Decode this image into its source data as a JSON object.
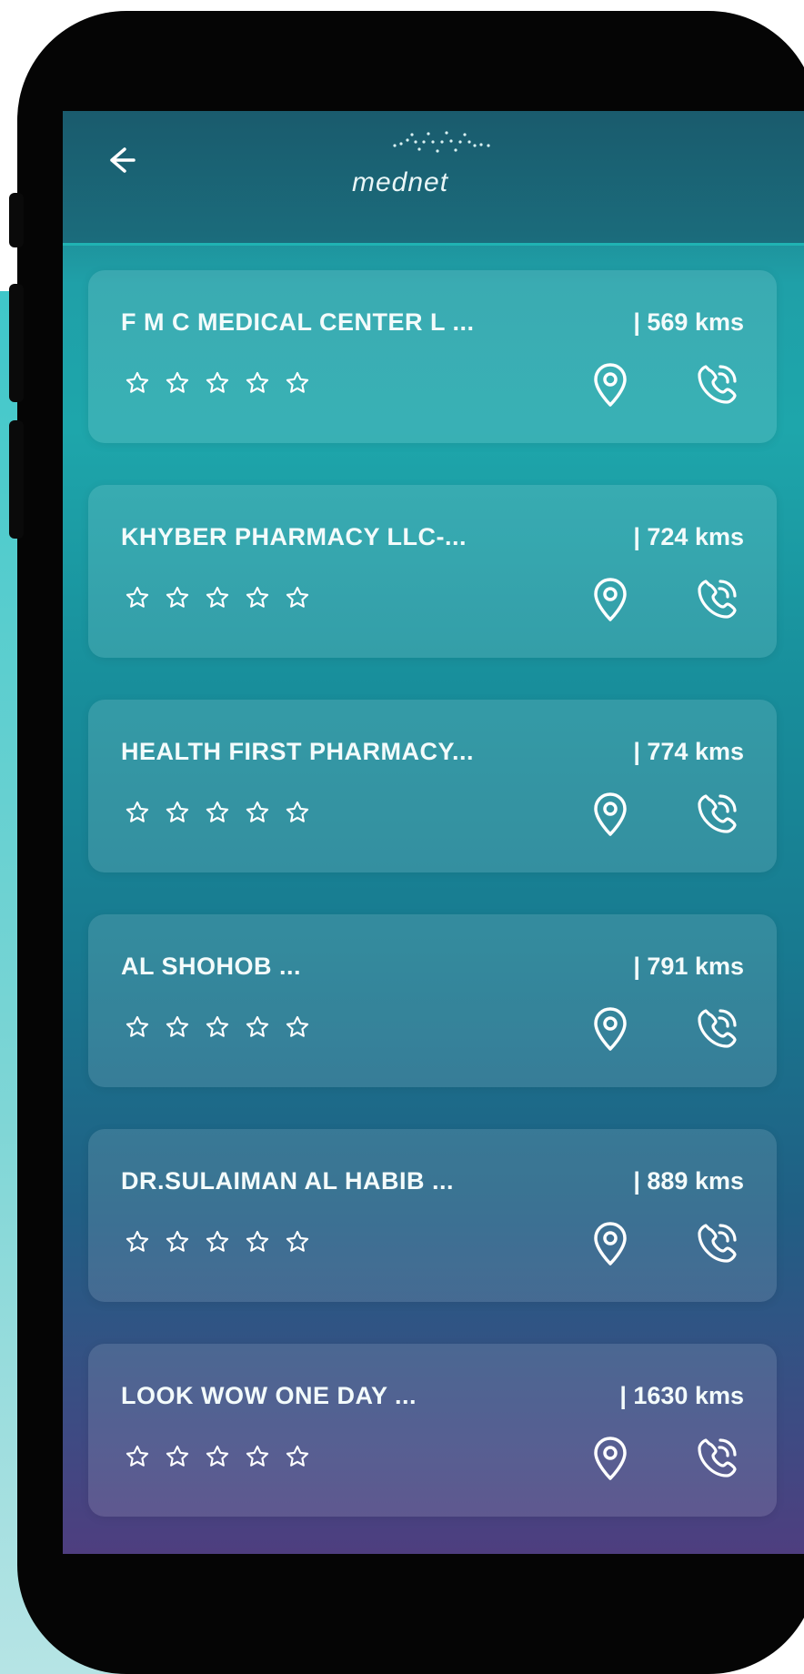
{
  "header": {
    "back_icon": "arrow-left-icon",
    "logo_text": "mednet"
  },
  "facilities": [
    {
      "name": "F M C MEDICAL CENTER L ...",
      "distance": "| 569 kms",
      "rating": 0,
      "max_rating": 5
    },
    {
      "name": "KHYBER PHARMACY LLC-...",
      "distance": "| 724 kms",
      "rating": 0,
      "max_rating": 5
    },
    {
      "name": "HEALTH FIRST PHARMACY...",
      "distance": "| 774 kms",
      "rating": 0,
      "max_rating": 5
    },
    {
      "name": "AL SHOHOB ...",
      "distance": "| 791 kms",
      "rating": 0,
      "max_rating": 5
    },
    {
      "name": "DR.SULAIMAN AL HABIB ...",
      "distance": "| 889 kms",
      "rating": 0,
      "max_rating": 5
    },
    {
      "name": "LOOK WOW ONE DAY ...",
      "distance": "| 1630 kms",
      "rating": 0,
      "max_rating": 5
    }
  ],
  "icons": {
    "location": "location-pin-icon",
    "phone": "phone-call-icon",
    "star": "star-outline-icon"
  },
  "colors": {
    "accent": "#20b3b3",
    "header_bg": "#1a5b6d",
    "text": "#f3fbfb"
  }
}
